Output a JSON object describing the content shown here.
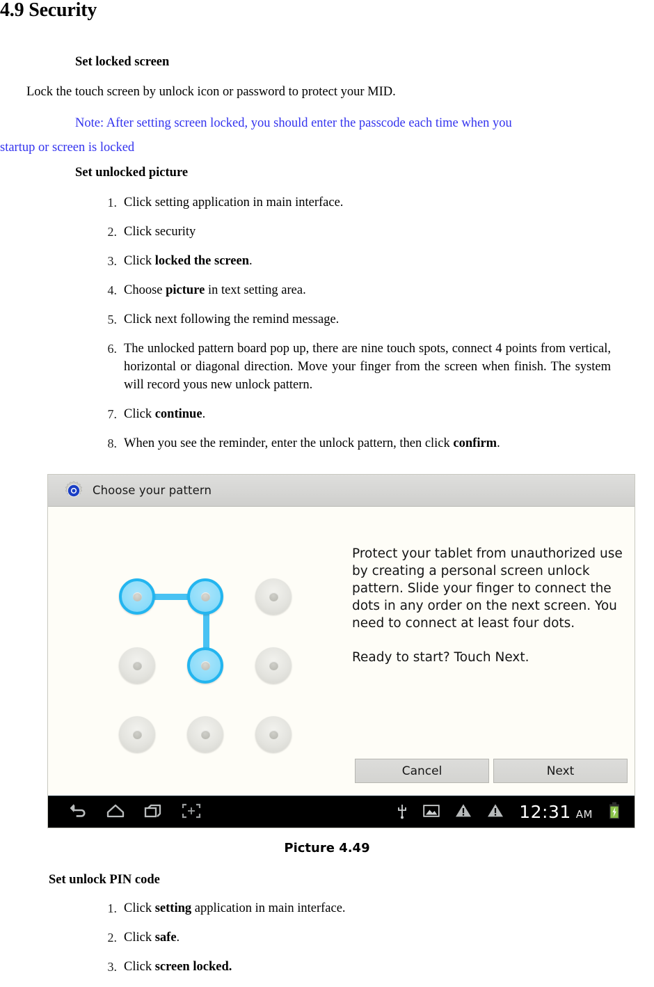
{
  "document": {
    "section_title": "4.9 Security",
    "headings": {
      "set_locked_screen": "Set locked screen",
      "set_unlocked_picture": "Set unlocked picture",
      "set_unlock_pin_code": "Set unlock PIN code"
    },
    "intro_paragraph": "Lock the touch screen by unlock icon or password to protect your MID.",
    "note": {
      "line1": "Note: After setting screen locked, you should enter the passcode each time when you",
      "line2": "startup or screen is locked",
      "color": "#3333ee"
    },
    "steps_pattern": [
      {
        "num": "1.",
        "html": "Click setting application in main interface."
      },
      {
        "num": "2.",
        "html": "Click security"
      },
      {
        "num": "3.",
        "html": "Click <b>locked the screen</b>."
      },
      {
        "num": "4.",
        "html": "Choose <b>picture</b> in text setting area."
      },
      {
        "num": "5.",
        "html": "Click next following the remind message."
      },
      {
        "num": "6.",
        "html": "The unlocked pattern board pop up, there are nine touch spots, connect 4 points from vertical, horizontal or diagonal direction. Move your finger from the screen when finish. The system will record yous new unlock pattern."
      },
      {
        "num": "7.",
        "html": "Click <b>continue</b>."
      },
      {
        "num": "8.",
        "html": "When you see the reminder, enter the unlock pattern, then click <b>confirm</b>."
      }
    ],
    "caption": "Picture 4.49",
    "steps_pin": [
      {
        "num": "1.",
        "html": "Click <b>setting</b> application in main interface."
      },
      {
        "num": "2.",
        "html": "Click <b>safe</b>."
      },
      {
        "num": "3.",
        "html": "Click <b>screen locked.</b>"
      }
    ]
  },
  "screenshot": {
    "header": {
      "title": "Choose your pattern",
      "icon": "settings-gear-icon",
      "icon_accent_color": "#1b3fc4",
      "background_color": "#d6d6d4"
    },
    "body_background_color": "#fefdf7",
    "description": {
      "paragraph": "Protect your tablet from unauthorized use by creating a personal screen unlock pattern. Slide your finger to connect the dots in any order on the next screen. You need to connect at least four dots.",
      "ready_line": "Ready to start? Touch Next."
    },
    "pattern": {
      "rows": 3,
      "cols": 3,
      "selected_dots": [
        1,
        2,
        5
      ],
      "path": "1-2-5",
      "selected_color": "#23b5ef",
      "line_color": "#39bdf2",
      "dot_color": "#e0e0da"
    },
    "buttons": [
      {
        "label": "Cancel",
        "name": "cancel-button"
      },
      {
        "label": "Next",
        "name": "next-button"
      }
    ],
    "navbar": {
      "background_color": "#000000",
      "left_icons": [
        "back-icon",
        "home-icon",
        "recent-apps-icon",
        "screenshot-capture-icon"
      ],
      "right_icons": [
        "usb-icon",
        "image-icon",
        "warning-icon",
        "warning-icon"
      ],
      "clock_time": "12:31",
      "clock_period": "AM",
      "battery_icon": "battery-charging-icon",
      "battery_color": "#8bc34a"
    }
  }
}
